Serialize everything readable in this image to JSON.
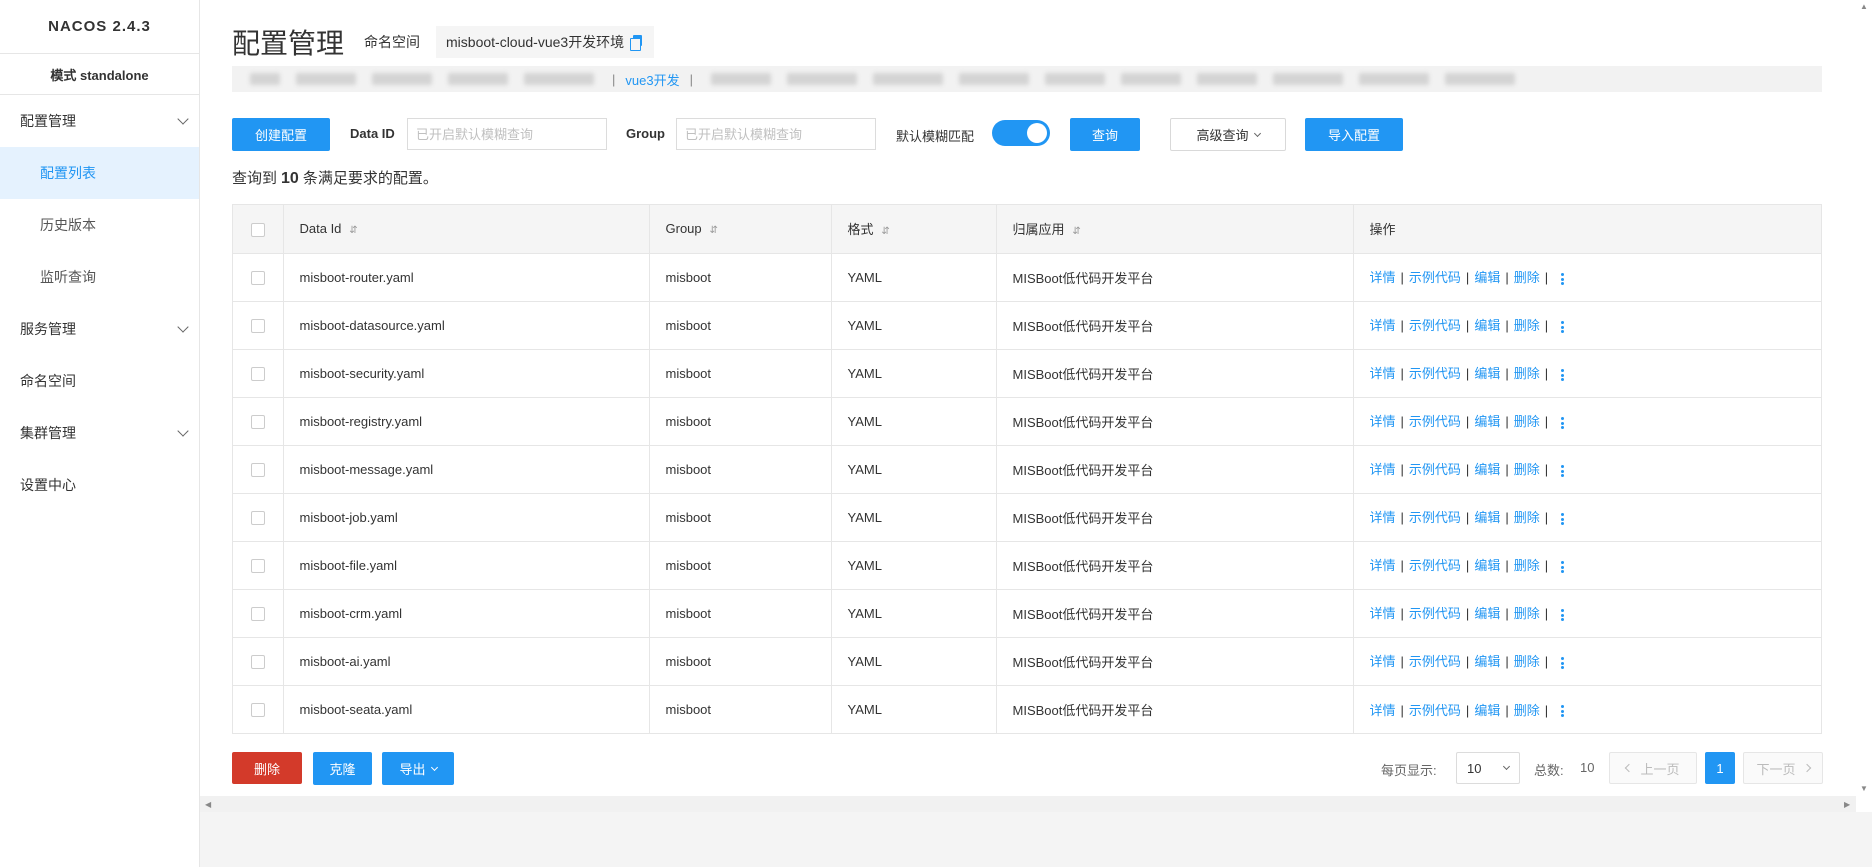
{
  "app": {
    "brand": "NACOS 2.4.3",
    "mode": "模式 standalone"
  },
  "sidebar": {
    "groups": [
      {
        "label": "配置管理",
        "expanded": true,
        "children": [
          "配置列表",
          "历史版本",
          "监听查询"
        ]
      },
      {
        "label": "服务管理",
        "expanded": false
      },
      {
        "label": "命名空间"
      },
      {
        "label": "集群管理",
        "expanded": false
      },
      {
        "label": "设置中心"
      }
    ],
    "active": "配置列表"
  },
  "header": {
    "title": "配置管理",
    "namespace_label": "命名空间",
    "namespace_value": "misboot-cloud-vue3开发环境",
    "namespace_bar_active": "vue3开发"
  },
  "toolbar": {
    "create_label": "创建配置",
    "dataid_label": "Data ID",
    "dataid_placeholder": "已开启默认模糊查询",
    "group_label": "Group",
    "group_placeholder": "已开启默认模糊查询",
    "fuzzy_label": "默认模糊匹配",
    "fuzzy_on": true,
    "query_label": "查询",
    "advanced_label": "高级查询",
    "import_label": "导入配置"
  },
  "result": {
    "prefix": "查询到",
    "count": "10",
    "suffix": "条满足要求的配置。"
  },
  "table": {
    "columns": [
      "Data Id",
      "Group",
      "格式",
      "归属应用",
      "操作"
    ],
    "rows": [
      {
        "dataId": "misboot-router.yaml",
        "group": "misboot",
        "format": "YAML",
        "app": "MISBoot低代码开发平台"
      },
      {
        "dataId": "misboot-datasource.yaml",
        "group": "misboot",
        "format": "YAML",
        "app": "MISBoot低代码开发平台"
      },
      {
        "dataId": "misboot-security.yaml",
        "group": "misboot",
        "format": "YAML",
        "app": "MISBoot低代码开发平台"
      },
      {
        "dataId": "misboot-registry.yaml",
        "group": "misboot",
        "format": "YAML",
        "app": "MISBoot低代码开发平台"
      },
      {
        "dataId": "misboot-message.yaml",
        "group": "misboot",
        "format": "YAML",
        "app": "MISBoot低代码开发平台"
      },
      {
        "dataId": "misboot-job.yaml",
        "group": "misboot",
        "format": "YAML",
        "app": "MISBoot低代码开发平台"
      },
      {
        "dataId": "misboot-file.yaml",
        "group": "misboot",
        "format": "YAML",
        "app": "MISBoot低代码开发平台"
      },
      {
        "dataId": "misboot-crm.yaml",
        "group": "misboot",
        "format": "YAML",
        "app": "MISBoot低代码开发平台"
      },
      {
        "dataId": "misboot-ai.yaml",
        "group": "misboot",
        "format": "YAML",
        "app": "MISBoot低代码开发平台"
      },
      {
        "dataId": "misboot-seata.yaml",
        "group": "misboot",
        "format": "YAML",
        "app": "MISBoot低代码开发平台"
      }
    ],
    "ops": [
      "详情",
      "示例代码",
      "编辑",
      "删除"
    ]
  },
  "footer": {
    "delete_label": "删除",
    "clone_label": "克隆",
    "export_label": "导出",
    "page_size_label": "每页显示:",
    "page_size": "10",
    "total_label": "总数:",
    "total": "10",
    "prev_label": "上一页",
    "next_label": "下一页",
    "current_page": "1"
  },
  "colors": {
    "primary": "#2196f3",
    "danger": "#d33a2a",
    "active_bg": "#e5f2fe"
  }
}
